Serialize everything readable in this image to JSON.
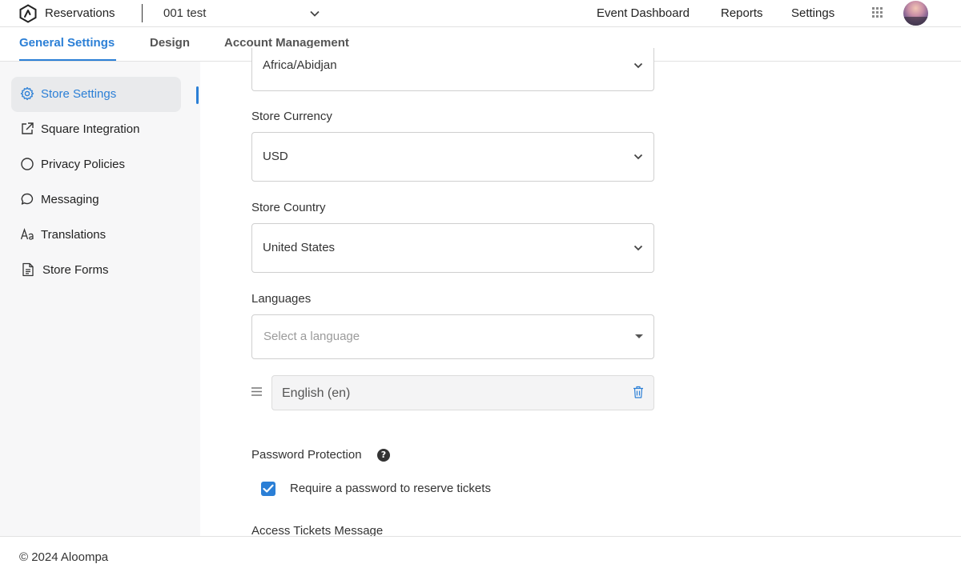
{
  "header": {
    "app_name": "Reservations",
    "store_name": "001 test",
    "nav": [
      "Event Dashboard",
      "Reports",
      "Settings"
    ]
  },
  "tabs": [
    {
      "label": "General Settings",
      "active": true
    },
    {
      "label": "Design",
      "active": false
    },
    {
      "label": "Account Management",
      "active": false
    }
  ],
  "sidebar": {
    "items": [
      {
        "label": "Store Settings",
        "icon": "gear-icon",
        "active": true
      },
      {
        "label": "Square Integration",
        "icon": "external-link-icon",
        "active": false
      },
      {
        "label": "Privacy Policies",
        "icon": "circle-icon",
        "active": false
      },
      {
        "label": "Messaging",
        "icon": "chat-bubble-icon",
        "active": false
      },
      {
        "label": "Translations",
        "icon": "translate-icon",
        "active": false
      },
      {
        "label": "Store Forms",
        "icon": "document-icon",
        "active": false
      }
    ]
  },
  "form": {
    "timezone_value": "Africa/Abidjan",
    "currency_label": "Store Currency",
    "currency_value": "USD",
    "country_label": "Store Country",
    "country_value": "United States",
    "languages_label": "Languages",
    "languages_placeholder": "Select a language",
    "selected_language": "English (en)",
    "password_label": "Password Protection",
    "help_glyph": "?",
    "require_password_label": "Require a password to reserve tickets",
    "require_password_checked": true,
    "access_message_label": "Access Tickets Message"
  },
  "colors": {
    "accent": "#2b7fd6",
    "sidebar_bg": "#f7f7f8"
  },
  "footer": {
    "copyright": "© 2024 Aloompa"
  }
}
